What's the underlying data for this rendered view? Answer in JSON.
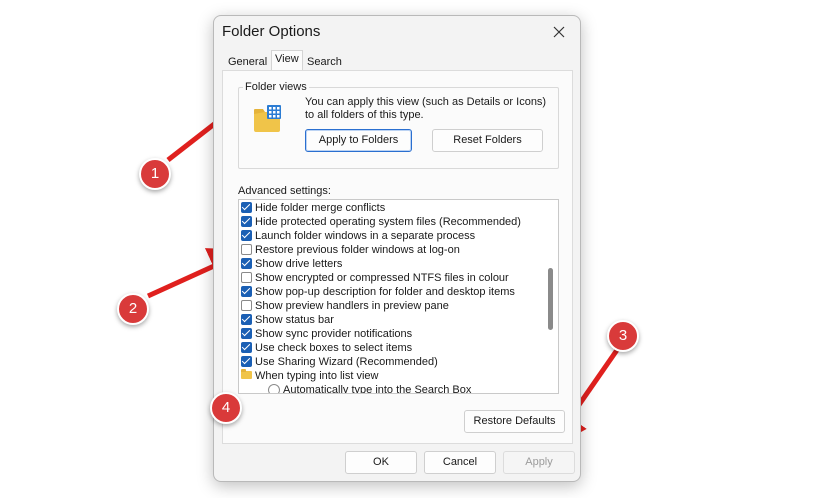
{
  "dialog": {
    "title": "Folder Options",
    "tabs": [
      "General",
      "View",
      "Search"
    ],
    "active_tab": "View"
  },
  "folder_views": {
    "label": "Folder views",
    "description": "You can apply this view (such as Details or Icons) to all folders of this type.",
    "apply_button": "Apply to Folders",
    "reset_button": "Reset Folders"
  },
  "advanced": {
    "label": "Advanced settings:",
    "items": [
      {
        "label": "Hide folder merge conflicts",
        "state": "checked"
      },
      {
        "label": "Hide protected operating system files (Recommended)",
        "state": "checked"
      },
      {
        "label": "Launch folder windows in a separate process",
        "state": "checked"
      },
      {
        "label": "Restore previous folder windows at log-on",
        "state": "unchecked"
      },
      {
        "label": "Show drive letters",
        "state": "checked"
      },
      {
        "label": "Show encrypted or compressed NTFS files in colour",
        "state": "unchecked"
      },
      {
        "label": "Show pop-up description for folder and desktop items",
        "state": "checked"
      },
      {
        "label": "Show preview handlers in preview pane",
        "state": "unchecked"
      },
      {
        "label": "Show status bar",
        "state": "checked"
      },
      {
        "label": "Show sync provider notifications",
        "state": "checked"
      },
      {
        "label": "Use check boxes to select items",
        "state": "checked"
      },
      {
        "label": "Use Sharing Wizard (Recommended)",
        "state": "checked"
      },
      {
        "label": "When typing into list view",
        "state": "folder"
      },
      {
        "label": "Automatically type into the Search Box",
        "state": "radio"
      }
    ],
    "restore_button": "Restore Defaults"
  },
  "footer": {
    "ok": "OK",
    "cancel": "Cancel",
    "apply": "Apply"
  },
  "annotations": [
    "1",
    "2",
    "3",
    "4"
  ],
  "colors": {
    "annotation": "#d93a3a",
    "checkbox": "#1a5fb4",
    "folder": "#f0c449"
  }
}
